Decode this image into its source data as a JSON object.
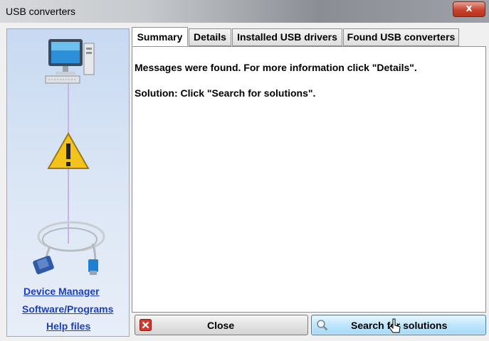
{
  "window": {
    "title": "USB converters",
    "close_glyph": "x"
  },
  "sidebar": {
    "links": [
      {
        "label": "Device Manager"
      },
      {
        "label": "Software/Programs"
      },
      {
        "label": "Help files"
      }
    ],
    "icons": [
      "computer-icon",
      "warning-icon",
      "usb-cable-icon"
    ]
  },
  "tabs": [
    {
      "label": "Summary",
      "selected": true
    },
    {
      "label": "Details",
      "selected": false
    },
    {
      "label": "Installed USB drivers",
      "selected": false
    },
    {
      "label": "Found USB converters",
      "selected": false
    }
  ],
  "summary": {
    "message": "Messages were found. For more information click \"Details\".",
    "solution": "Solution: Click \"Search for solutions\"."
  },
  "buttons": {
    "close_label": "Close",
    "search_label": "Search for solutions"
  },
  "colors": {
    "link": "#1a3fbf",
    "warning": "#f3c21b",
    "close_icon": "#d9362b"
  }
}
